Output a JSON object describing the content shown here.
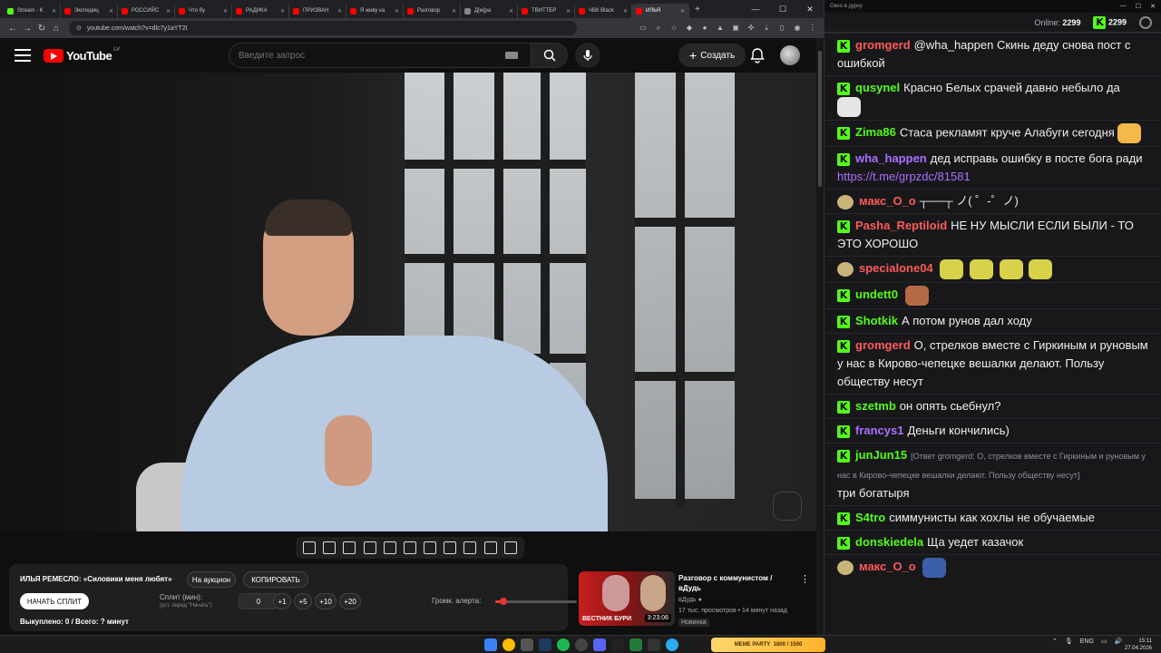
{
  "browser": {
    "tabs": [
      {
        "label": "Stream - K",
        "color": "#53fc18"
      },
      {
        "label": "Экспедиц",
        "color": "#ff0000"
      },
      {
        "label": "РОССИЙС",
        "color": "#ff0000"
      },
      {
        "label": "Что бу",
        "color": "#ff0000"
      },
      {
        "label": "РАДИКА",
        "color": "#ff0000"
      },
      {
        "label": "ПРИЗВАН",
        "color": "#ff0000"
      },
      {
        "label": "Я живу ка",
        "color": "#ff0000"
      },
      {
        "label": "Разговор",
        "color": "#ff0000"
      },
      {
        "label": "Д[м]ра",
        "color": "#888888"
      },
      {
        "label": "ТВИТТЕР",
        "color": "#ff0000"
      },
      {
        "label": "ЧВК Black",
        "color": "#ff0000"
      },
      {
        "label": "ИЛЬЯ",
        "color": "#ff0000",
        "active": true
      }
    ],
    "url": "youtube.com/watch?v=dlc7y1aYT2I",
    "new_tab": "+"
  },
  "youtube": {
    "logo_text": "YouTube",
    "region": "LV",
    "search_placeholder": "Введите запрос",
    "create_label": "Создать",
    "create_plus": "+"
  },
  "panel": {
    "title": "ИЛЬЯ РЕМЕСЛО: «Силовики меня любят»",
    "auction_label": "На аукцион",
    "copy_label": "КОПИРОВАТЬ",
    "start_split_label": "НАЧАТЬ СПЛИТ",
    "split_label": "Сплит (мин):",
    "split_hint": "(уст. перед \"Начать\")",
    "split_value": "0",
    "increments": [
      "+1",
      "+5",
      "+10",
      "+20"
    ],
    "alert_label": "Громк. алерта:",
    "alert_level": 0.1,
    "status": "Выкуплено: 0 / Всего: ? минут"
  },
  "recommendation": {
    "title": "Разговор с коммунистом / вДудь",
    "channel": "вДудь",
    "meta": "17 тыс. просмотров • 14 минут назад",
    "badge": "Новинка",
    "thumb_caption": "ВЕСТНИК БУРИ",
    "duration": "3:23:06",
    "more_icon": "⋮"
  },
  "chat": {
    "window_title": "Окно в дурку",
    "online_label": "Online:",
    "online_count": "2299",
    "kick_count": "2299",
    "messages": [
      {
        "user": "gromgerd",
        "color": "#ff5a5a",
        "badge": "kick",
        "text": "@wha_happen Скинь деду снова пост с ошибкой",
        "mention": "@wha_happen"
      },
      {
        "user": "qusynel",
        "color": "#53fc18",
        "badge": "kick",
        "text": "Красно Белых срачей давно небыло да",
        "emote": "trollface"
      },
      {
        "user": "Zima86",
        "color": "#53fc18",
        "badge": "kick",
        "text": "Стаса рекламят круче Алабуги сегодня",
        "emote": "cool"
      },
      {
        "user": "wha_happen",
        "color": "#a970ff",
        "badge": "kick",
        "text": "дед исправь ошибку в посте бога ради",
        "link": "https://t.me/grpzdc/81581"
      },
      {
        "user": "макс_О_о",
        "color": "#ff5a5a",
        "badge": "face",
        "text": "┬──┬ ノ( ゜-゜ノ)"
      },
      {
        "user": "Pasha_Reptiloid",
        "color": "#ff5a5a",
        "badge": "kick",
        "text": "НЕ НУ МЫСЛИ ЕСЛИ БЫЛИ - ТО ЭТО ХОРОШО"
      },
      {
        "user": "specialone04",
        "color": "#ff5a5a",
        "badge": "face",
        "text": "",
        "emotes": 4
      },
      {
        "user": "undett0",
        "color": "#53fc18",
        "badge": "kick",
        "text": "",
        "emote": "face"
      },
      {
        "user": "Shotkik",
        "color": "#53fc18",
        "badge": "kick",
        "text": "А потом рунов дал ходу"
      },
      {
        "user": "gromgerd",
        "color": "#ff5a5a",
        "badge": "kick",
        "text": "О, стрелков вместе с Гиркиным и руновым у нас в Кирово-чепецке вешалки делают. Пользу обществу несут"
      },
      {
        "user": "szetmb",
        "color": "#53fc18",
        "badge": "kick",
        "text": "он опять сьебнул?"
      },
      {
        "user": "francys1",
        "color": "#a970ff",
        "badge": "kick",
        "text": "Деньги кончились)"
      },
      {
        "user": "junJun15",
        "color": "#53fc18",
        "badge": "kick",
        "reply": "[Ответ gromgerd: О, стрелков вместе с Гиркиным и руновым у нас в Кирово-чепецке вешалки делают. Пользу обществу несут]",
        "text": "три богатыря"
      },
      {
        "user": "S4tro",
        "color": "#53fc18",
        "badge": "kick",
        "text": "симмунисты как хохлы не обучаемые"
      },
      {
        "user": "donskiedela",
        "color": "#53fc18",
        "badge": "kick",
        "text": "Ща уедет казачок"
      },
      {
        "user": "макс_О_о",
        "color": "#ff5a5a",
        "badge": "face",
        "text": "",
        "emote": "badge"
      }
    ]
  },
  "taskbar": {
    "meme_party": "MEME PARTY",
    "meme_progress": "1800 / 1500",
    "lang": "ENG",
    "time": "15:11",
    "date": "27.04.2026"
  }
}
